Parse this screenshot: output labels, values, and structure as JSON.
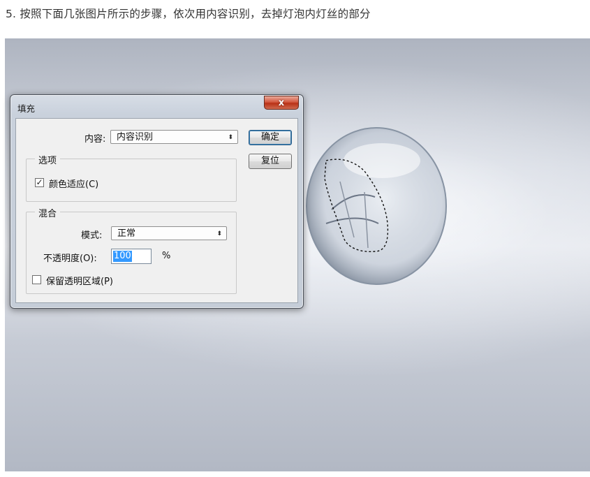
{
  "caption": "5. 按照下面几张图片所示的步骤，依次用内容识别，去掉灯泡内灯丝的部分",
  "dialog": {
    "title": "填充",
    "close_glyph": "x",
    "content_label": "内容:",
    "content_value": "内容识别",
    "ok_label": "确定",
    "reset_label": "复位",
    "options_group": "选项",
    "color_adapt_label": "颜色适应(C)",
    "color_adapt_checked": true,
    "blend_group": "混合",
    "mode_label": "模式:",
    "mode_value": "正常",
    "opacity_label": "不透明度(O):",
    "opacity_value": "100",
    "opacity_unit": "%",
    "preserve_label": "保留透明区域(P)",
    "preserve_checked": false,
    "check_glyph": "✓",
    "select_arrow": "⬍"
  }
}
